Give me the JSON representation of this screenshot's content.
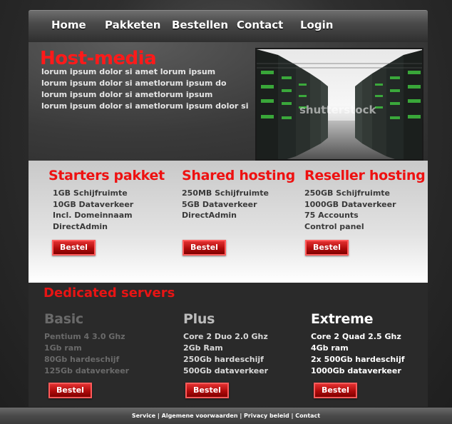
{
  "nav": {
    "items": [
      "Home",
      "Pakketen",
      "Bestellen",
      "Contact",
      "Login"
    ]
  },
  "hero": {
    "title": "Host-media",
    "lines": [
      "lorum ipsum dolor si amet lorum ipsum",
      "lorum ipsum dolor si ametlorum ipsum do",
      "lorum ipsum dolor si ametlorum ipsum",
      "lorum ipsum dolor si ametlorum ipsum dolor si"
    ],
    "image_watermark": "shutterstock"
  },
  "packages": [
    {
      "title": "Starters pakket",
      "features": [
        "1GB Schijfruimte",
        "10GB Dataverkeer",
        "Incl. Domeinnaam",
        "DirectAdmin"
      ],
      "button": "Bestel"
    },
    {
      "title": "Shared hosting",
      "features": [
        "250MB Schijfruimte",
        "5GB Dataverkeer",
        "DirectAdmin"
      ],
      "button": "Bestel"
    },
    {
      "title": "Reseller hosting",
      "features": [
        "250GB Schijfruimte",
        "1000GB Dataverkeer",
        "75 Accounts",
        "Control panel"
      ],
      "button": "Bestel"
    }
  ],
  "dedicated": {
    "title": "Dedicated servers",
    "tiers": [
      {
        "name": "Basic",
        "features": [
          "Pentium 4 3.0 Ghz",
          "1Gb ram",
          "80Gb hardeschijf",
          "125Gb dataverkeer"
        ],
        "button": "Bestel"
      },
      {
        "name": "Plus",
        "features": [
          "Core 2 Duo 2.0 Ghz",
          "2Gb Ram",
          "250Gb hardeschijf",
          "500Gb dataverkeer"
        ],
        "button": "Bestel"
      },
      {
        "name": "Extreme",
        "features": [
          "Core 2 Quad 2.5 Ghz",
          "4Gb ram",
          "2x 500Gb hardeschijf",
          "1000Gb dataverkeer"
        ],
        "button": "Bestel"
      }
    ]
  },
  "footer": {
    "links": [
      "Service",
      "Algemene voorwaarden",
      "Privacy beleid",
      "Contact"
    ]
  },
  "colors": {
    "accent_red": "#ee1111",
    "background_dark": "#2a2a2a",
    "panel_light": "#e2e2e2"
  }
}
